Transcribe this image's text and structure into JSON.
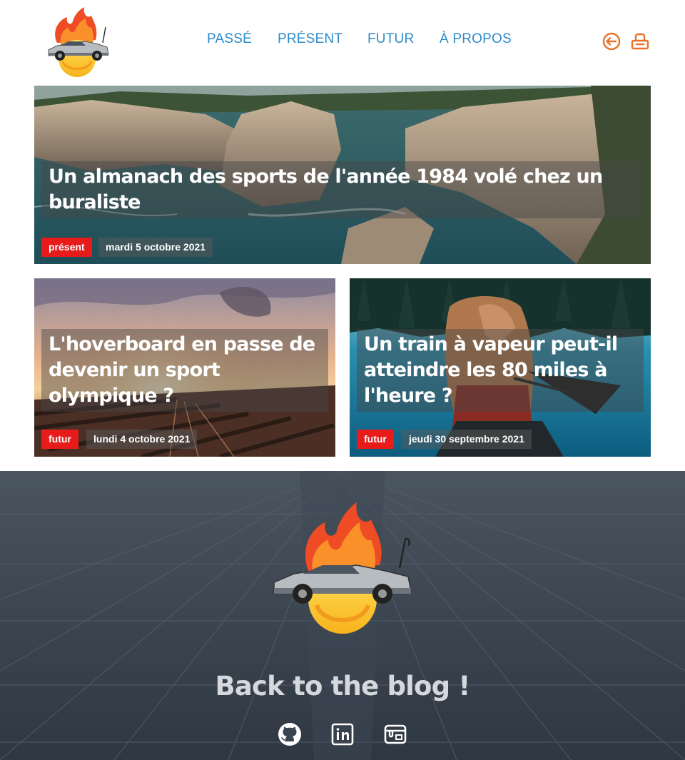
{
  "header": {
    "logo": "flaming-delorean-logo",
    "nav": [
      {
        "label": "PASSÉ"
      },
      {
        "label": "PRÉSENT"
      },
      {
        "label": "FUTUR"
      },
      {
        "label": "À PROPOS"
      }
    ],
    "icons": [
      "login-icon",
      "rss-icon"
    ],
    "accent_color": "#e8732a",
    "nav_color": "#2d8bc9"
  },
  "posts": [
    {
      "title": "Un almanach des sports de l'année 1984 volé chez un buraliste",
      "tag": "présent",
      "date": "mardi 5 octobre 2021",
      "image": "coastal-cliffs-photo"
    },
    {
      "title": "L'hoverboard en passe de devenir un sport olympique ?",
      "tag": "futur",
      "date": "lundi 4 octobre 2021",
      "image": "railway-yard-sunset-photo"
    },
    {
      "title": "Un train à vapeur peut-il atteindre les 80 miles à l'heure ?",
      "tag": "futur",
      "date": "jeudi 30 septembre 2021",
      "image": "woman-canoe-lake-photo"
    }
  ],
  "tag_color": "#e81b1b",
  "footer": {
    "title": "Back to the blog !",
    "logo": "flaming-delorean-logo",
    "icons": [
      "github-icon",
      "linkedin-icon",
      "blog-icon"
    ]
  }
}
